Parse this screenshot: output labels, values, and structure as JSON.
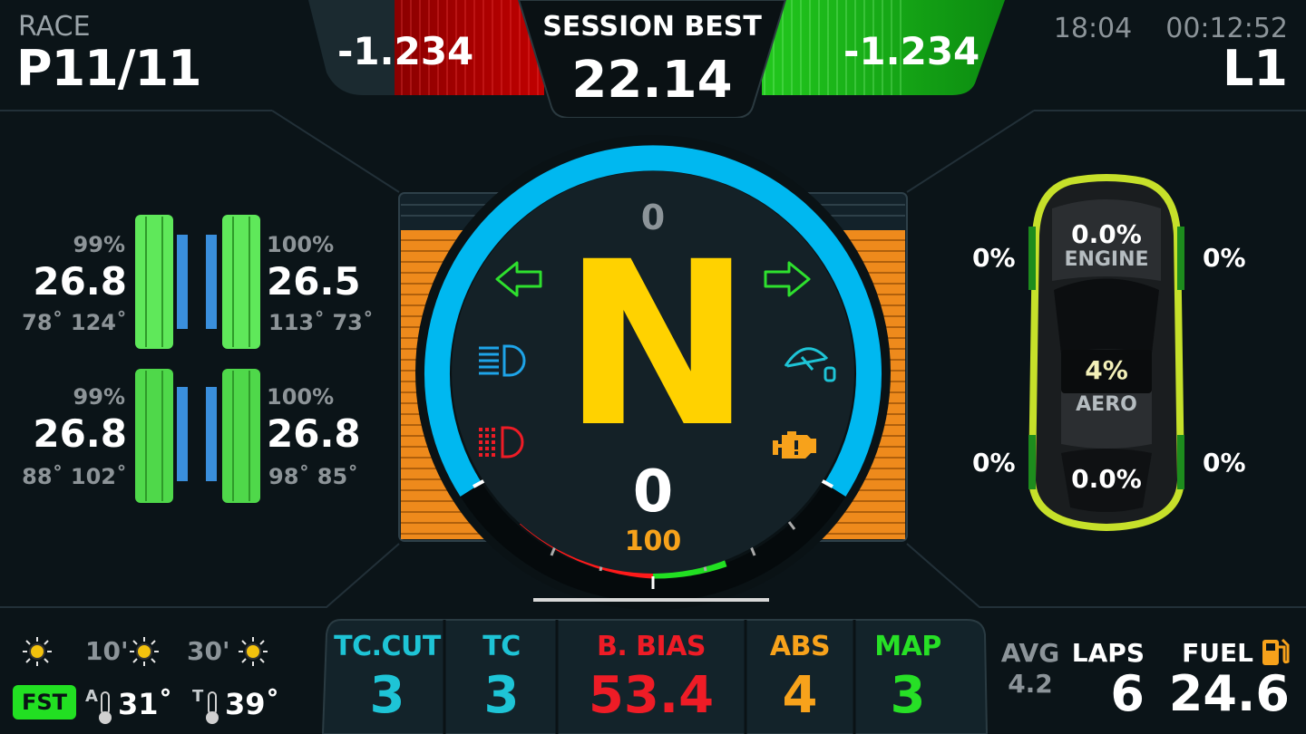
{
  "header": {
    "session_type": "RACE",
    "position": "P11/11",
    "delta_left": "-1.234",
    "session_best_label": "SESSION BEST",
    "session_best_value": "22.14",
    "delta_right": "-1.234",
    "clock": "18:04",
    "session_time": "00:12:52",
    "lap": "L1"
  },
  "tyres": {
    "front_left": {
      "wear": "99%",
      "pressure": "26.8",
      "temps": "78˚ 124˚"
    },
    "front_right": {
      "wear": "100%",
      "pressure": "26.5",
      "temps": "113˚ 73˚"
    },
    "rear_left": {
      "wear": "99%",
      "pressure": "26.8",
      "temps": "88˚ 102˚"
    },
    "rear_right": {
      "wear": "100%",
      "pressure": "26.8",
      "temps": "98˚ 85˚"
    }
  },
  "gauge": {
    "rpm_top": "0",
    "gear": "N",
    "speed": "0",
    "fuel_pct": "100"
  },
  "damage": {
    "engine_pct": "0.0%",
    "engine_label": "ENGINE",
    "aero_pct": "4%",
    "aero_label": "AERO",
    "front_left": "0%",
    "front_right": "0%",
    "rear_left": "0%",
    "rear_right": "0%",
    "rear_center": "0.0%"
  },
  "weather": {
    "now_label": "",
    "t10_label": "10'",
    "t30_label": "30'",
    "fst_label": "FST",
    "air_prefix": "A",
    "air_temp": "31˚",
    "track_prefix": "T",
    "track_temp": "39˚"
  },
  "settings": [
    {
      "label": "TC.CUT",
      "value": "3",
      "color": "#1ec4d6"
    },
    {
      "label": "TC",
      "value": "3",
      "color": "#1ec4d6"
    },
    {
      "label": "B. BIAS",
      "value": "53.4",
      "color": "#ee1c26"
    },
    {
      "label": "ABS",
      "value": "4",
      "color": "#f7a21b"
    },
    {
      "label": "MAP",
      "value": "3",
      "color": "#27e026"
    }
  ],
  "stats": {
    "avg_label": "AVG",
    "avg_value": "4.2",
    "laps_label": "LAPS",
    "laps_value": "6",
    "fuel_label": "FUEL",
    "fuel_value": "24.6"
  },
  "colors": {
    "accent_blue": "#00b8f0",
    "gear_yellow": "#ffd200",
    "tyre_green": "#5fe85a",
    "delta_red": "#b00000",
    "delta_green": "#13b01a",
    "orange_bar": "#ee8a1c"
  }
}
